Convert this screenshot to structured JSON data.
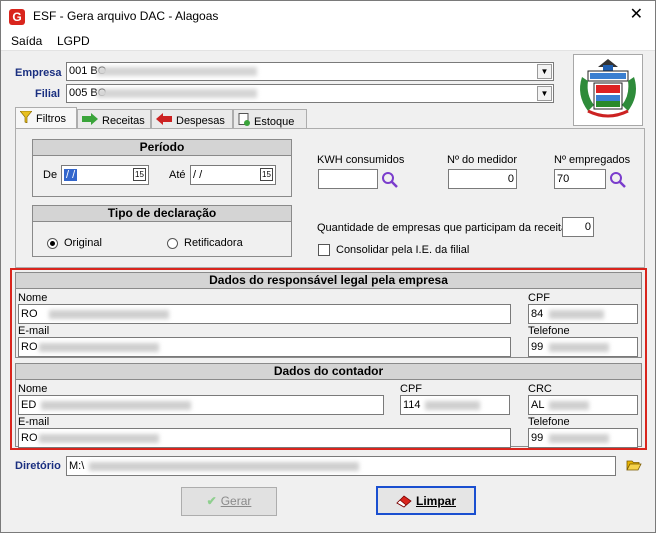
{
  "window": {
    "title": "ESF - Gera arquivo DAC - Alagoas",
    "app_icon": "G",
    "close": "✕"
  },
  "menu": {
    "items": [
      "Saída",
      "LGPD"
    ]
  },
  "empresa": {
    "label": "Empresa",
    "value": "001 BO"
  },
  "filial": {
    "label": "Filial",
    "value": "005 BO"
  },
  "tabs": [
    {
      "label": "Filtros",
      "icon": "filter-icon"
    },
    {
      "label": "Receitas",
      "icon": "arrow-right-icon"
    },
    {
      "label": "Despesas",
      "icon": "arrow-left-icon"
    },
    {
      "label": "Estoque",
      "icon": "document-add-icon"
    }
  ],
  "periodo": {
    "title": "Período",
    "de_label": "De",
    "de_value": " / / ",
    "ate_label": "Até",
    "ate_value": " / / ",
    "cal_glyph": "15"
  },
  "tipo": {
    "title": "Tipo de declaração",
    "original": "Original",
    "retificadora": "Retificadora",
    "selected": "Original"
  },
  "kwh": {
    "label": "KWH consumidos",
    "value": ""
  },
  "medidor": {
    "label": "Nº do medidor",
    "value": "0"
  },
  "empregados": {
    "label": "Nº empregados",
    "value": "70"
  },
  "qtd_empresas": {
    "label": "Quantidade de empresas que participam da receita",
    "value": "0"
  },
  "consolidar": {
    "label": "Consolidar pela I.E. da filial",
    "checked": false
  },
  "responsavel": {
    "title": "Dados do responsável legal pela empresa",
    "nome_label": "Nome",
    "nome_value": "RO",
    "cpf_label": "CPF",
    "cpf_value": "84",
    "email_label": "E-mail",
    "email_value": "RO",
    "telefone_label": "Telefone",
    "telefone_value": "99"
  },
  "contador": {
    "title": "Dados do contador",
    "nome_label": "Nome",
    "nome_value": "ED",
    "cpf_label": "CPF",
    "cpf_value": "114",
    "crc_label": "CRC",
    "crc_value": "AL",
    "email_label": "E-mail",
    "email_value": "RO",
    "telefone_label": "Telefone",
    "telefone_value": "99"
  },
  "diretorio": {
    "label": "Diretório",
    "value": "M:\\"
  },
  "buttons": {
    "gerar": "Gerar",
    "limpar": "Limpar"
  },
  "colors": {
    "label_blue": "#1a2f80",
    "highlight_red": "#d9251d",
    "primary_border": "#1a4fd0"
  }
}
